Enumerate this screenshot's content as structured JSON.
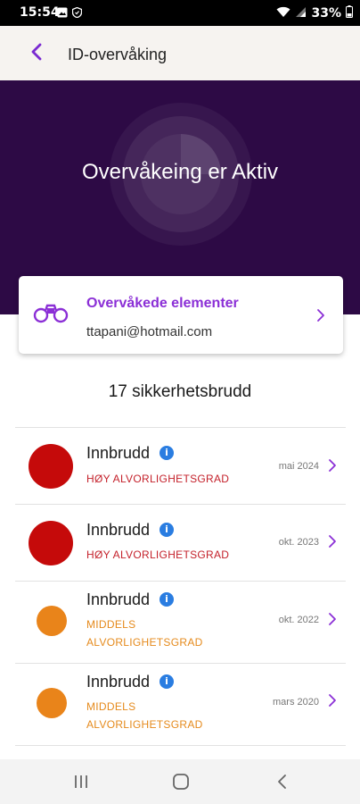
{
  "status_bar": {
    "time": "15:54",
    "battery": "33%",
    "icons_left": [
      "image-icon",
      "shield-icon"
    ],
    "icons_right": [
      "wifi-icon",
      "signal-icon",
      "battery-icon"
    ]
  },
  "header": {
    "title": "ID-overvåking",
    "back_icon": "chevron-left-icon"
  },
  "hero": {
    "title": "Overvåkeing er Aktiv"
  },
  "monitored_card": {
    "title": "Overvåkede elementer",
    "subtitle": "ttapani@hotmail.com",
    "icon": "binoculars-icon"
  },
  "breach_count": "17 sikkerhetsbrudd",
  "breaches": [
    {
      "title": "Innbrudd",
      "severity_line1": "HØY ALVORLIGHETSGRAD",
      "severity_line2": "",
      "date": "mai 2024",
      "level": "high"
    },
    {
      "title": "Innbrudd",
      "severity_line1": "HØY ALVORLIGHETSGRAD",
      "severity_line2": "",
      "date": "okt. 2023",
      "level": "high"
    },
    {
      "title": "Innbrudd",
      "severity_line1": "MIDDELS",
      "severity_line2": "ALVORLIGHETSGRAD",
      "date": "okt. 2022",
      "level": "medium"
    },
    {
      "title": "Innbrudd",
      "severity_line1": "MIDDELS",
      "severity_line2": "ALVORLIGHETSGRAD",
      "date": "mars 2020",
      "level": "medium"
    }
  ],
  "colors": {
    "accent": "#8b2fd6",
    "hero_bg": "#2d0a45",
    "high": "#c50a0a",
    "high_text": "#c4212b",
    "medium": "#e9841a",
    "medium_text": "#e58a1c",
    "info": "#2a7de1"
  },
  "nav_bar": {
    "icons": [
      "recent-apps-icon",
      "home-icon",
      "back-icon"
    ]
  }
}
